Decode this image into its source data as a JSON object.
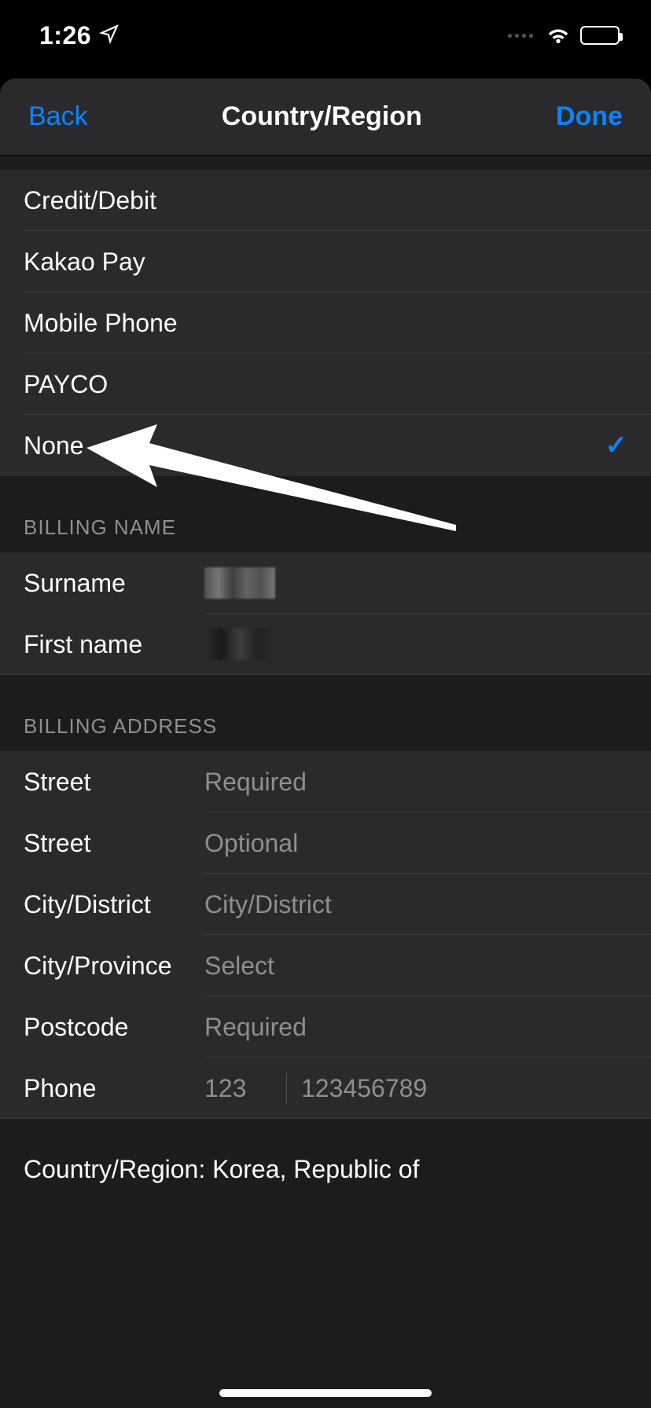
{
  "status": {
    "time": "1:26"
  },
  "nav": {
    "back": "Back",
    "title": "Country/Region",
    "done": "Done"
  },
  "payment_methods": [
    {
      "label": "Credit/Debit",
      "selected": false
    },
    {
      "label": "Kakao Pay",
      "selected": false
    },
    {
      "label": "Mobile Phone",
      "selected": false
    },
    {
      "label": "PAYCO",
      "selected": false
    },
    {
      "label": "None",
      "selected": true
    }
  ],
  "sections": {
    "billing_name": "BILLING NAME",
    "billing_address": "BILLING ADDRESS"
  },
  "billing_name": {
    "surname_label": "Surname",
    "firstname_label": "First name"
  },
  "billing_address": {
    "street_label": "Street",
    "street_placeholder": "Required",
    "street2_label": "Street",
    "street2_placeholder": "Optional",
    "city_label": "City/District",
    "city_placeholder": "City/District",
    "province_label": "City/Province",
    "province_placeholder": "Select",
    "postcode_label": "Postcode",
    "postcode_placeholder": "Required",
    "phone_label": "Phone",
    "phone_prefix_placeholder": "123",
    "phone_number_placeholder": "123456789"
  },
  "footer": {
    "country_region_label": "Country/Region: Korea, Republic of"
  }
}
